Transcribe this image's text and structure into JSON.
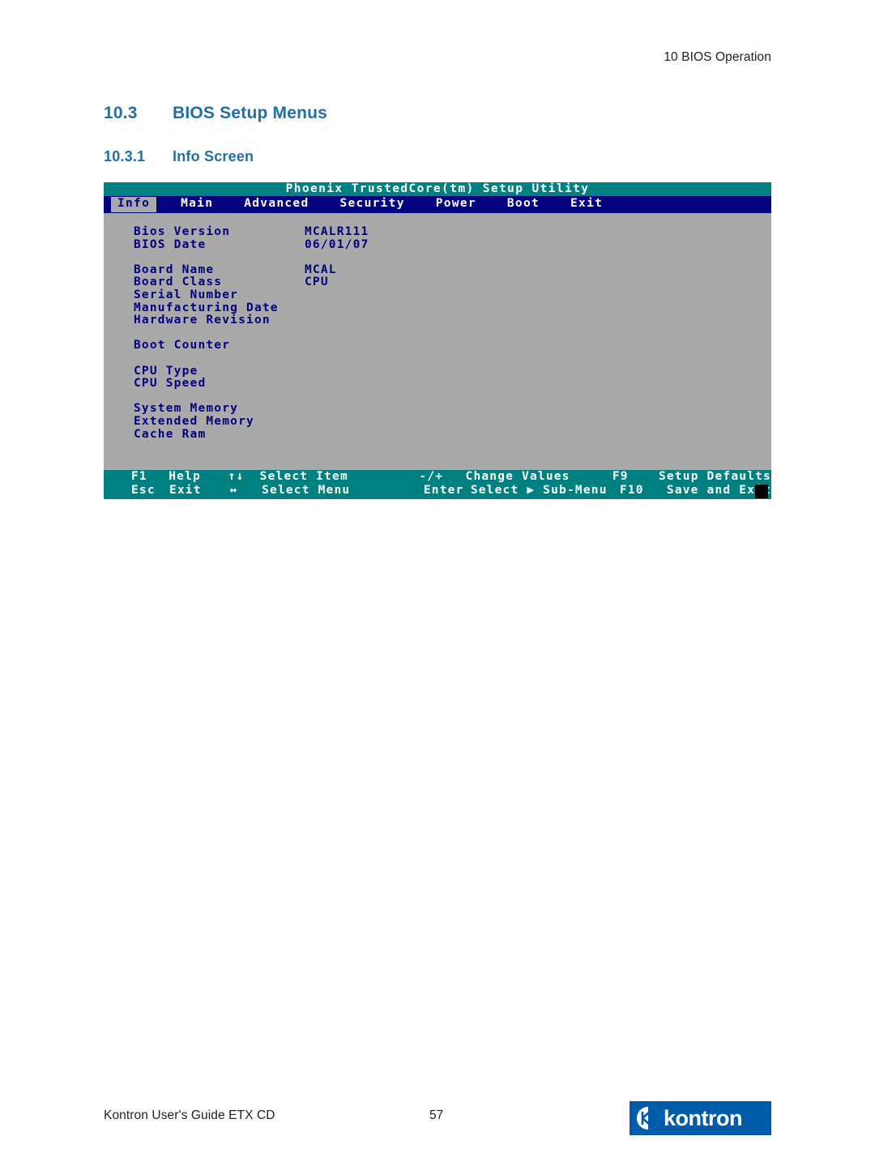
{
  "page": {
    "header_right": "10 BIOS Operation",
    "footer_left": "Kontron User's Guide ETX CD",
    "footer_page": "57",
    "logo_text": "kontron"
  },
  "headings": {
    "h1_number": "10.3",
    "h1_text": "BIOS Setup Menus",
    "h2_number": "10.3.1",
    "h2_text": "Info Screen"
  },
  "bios": {
    "title": "Phoenix TrustedCore(tm) Setup Utility",
    "tabs": [
      {
        "label": "Info",
        "active": true
      },
      {
        "label": "Main",
        "active": false
      },
      {
        "label": "Advanced",
        "active": false
      },
      {
        "label": "Security",
        "active": false
      },
      {
        "label": "Power",
        "active": false
      },
      {
        "label": "Boot",
        "active": false
      },
      {
        "label": "Exit",
        "active": false
      }
    ],
    "items": [
      {
        "label": "Bios Version",
        "value": "MCALR111"
      },
      {
        "label": "BIOS Date",
        "value": "06/01/07"
      },
      {
        "label": "",
        "value": ""
      },
      {
        "label": "Board Name",
        "value": "MCAL"
      },
      {
        "label": "Board Class",
        "value": "CPU"
      },
      {
        "label": "Serial Number",
        "value": ""
      },
      {
        "label": "Manufacturing Date",
        "value": ""
      },
      {
        "label": "Hardware Revision",
        "value": ""
      },
      {
        "label": "",
        "value": ""
      },
      {
        "label": "Boot Counter",
        "value": ""
      },
      {
        "label": "",
        "value": ""
      },
      {
        "label": "CPU Type",
        "value": ""
      },
      {
        "label": "CPU Speed",
        "value": ""
      },
      {
        "label": "",
        "value": ""
      },
      {
        "label": "System Memory",
        "value": ""
      },
      {
        "label": "Extended Memory",
        "value": ""
      },
      {
        "label": "Cache Ram",
        "value": ""
      }
    ],
    "footer": {
      "line1": {
        "key": "F1",
        "action": "Help",
        "arrows": "↑↓",
        "desc": "Select Item",
        "key2": "-/+",
        "desc2": "Change Values",
        "key3": "F9",
        "desc3": "Setup Defaults"
      },
      "line2": {
        "key": "Esc",
        "action": "Exit",
        "arrows": "↔",
        "desc": "Select Menu",
        "key2": "Enter",
        "desc2": "Select ▶ Sub-Menu",
        "key3": "F10",
        "desc3": "Save and Exit"
      }
    }
  }
}
